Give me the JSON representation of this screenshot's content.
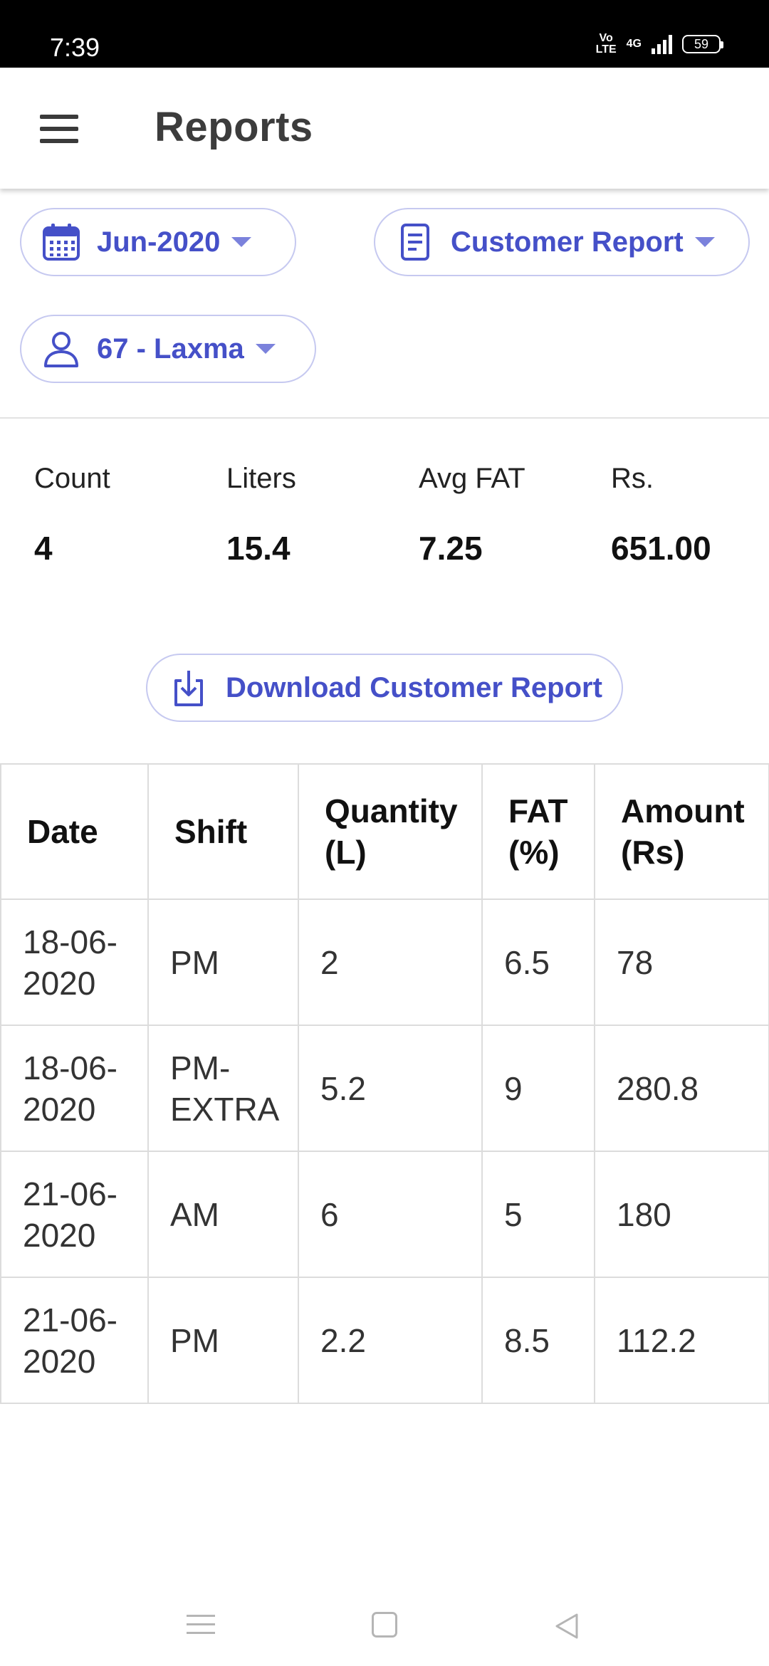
{
  "status_bar": {
    "time": "7:39",
    "volte_top": "Vo",
    "volte_bottom": "LTE",
    "network": "4G",
    "battery": "59"
  },
  "app_bar": {
    "title": "Reports",
    "menu_icon": "hamburger-menu-icon"
  },
  "filters": {
    "month": {
      "label": "Jun-2020",
      "icon": "calendar-icon"
    },
    "report_type": {
      "label": "Customer Report",
      "icon": "document-icon"
    },
    "customer": {
      "label": "67 - Laxma",
      "icon": "person-icon"
    }
  },
  "summary": [
    {
      "label": "Count",
      "value": "4"
    },
    {
      "label": "Liters",
      "value": "15.4"
    },
    {
      "label": "Avg FAT",
      "value": "7.25"
    },
    {
      "label": "Rs.",
      "value": "651.00"
    }
  ],
  "download_button": {
    "label": "Download Customer Report",
    "icon": "download-icon"
  },
  "table": {
    "headers": [
      "Date",
      "Shift",
      "Quantity (L)",
      "FAT (%)",
      "Amount (Rs)"
    ],
    "rows": [
      [
        "18-06-2020",
        "PM",
        "2",
        "6.5",
        "78"
      ],
      [
        "18-06-2020",
        "PM-EXTRA",
        "5.2",
        "9",
        "280.8"
      ],
      [
        "21-06-2020",
        "AM",
        "6",
        "5",
        "180"
      ],
      [
        "21-06-2020",
        "PM",
        "2.2",
        "8.5",
        "112.2"
      ]
    ]
  },
  "colors": {
    "accent": "#4550c8",
    "chip_border": "#c6c9f0",
    "status_bar": "#000000"
  }
}
